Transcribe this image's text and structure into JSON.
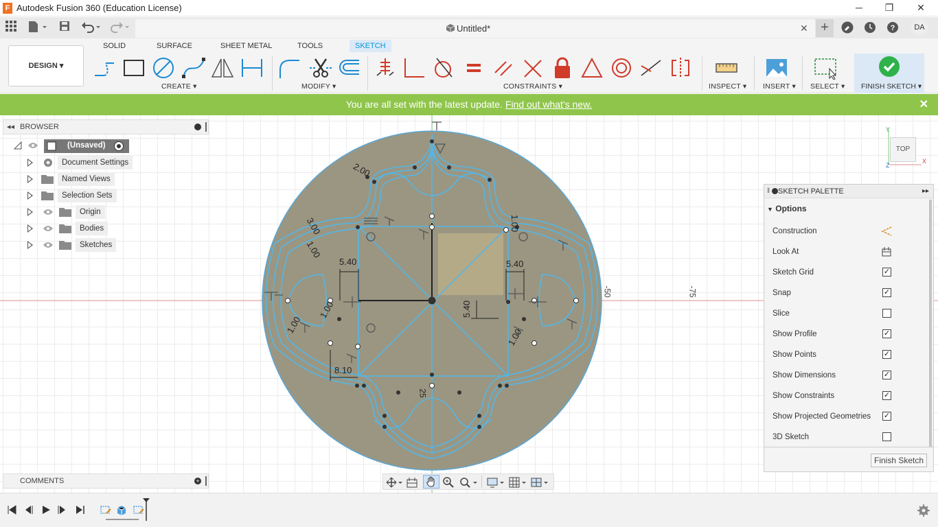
{
  "window": {
    "title": "Autodesk Fusion 360 (Education License)",
    "app_icon_letter": "F",
    "minimize": "─",
    "restore": "❐",
    "close": "✕"
  },
  "tabbar": {
    "document_title": "Untitled*",
    "close": "✕",
    "new_tab": "+",
    "user_initials": "DA"
  },
  "toolbar": {
    "workspace": "DESIGN ▾",
    "tabs": [
      "SOLID",
      "SURFACE",
      "SHEET METAL",
      "TOOLS",
      "SKETCH"
    ],
    "active_tab": "SKETCH",
    "groups": {
      "create": "CREATE ▾",
      "modify": "MODIFY ▾",
      "constraints": "CONSTRAINTS ▾",
      "inspect": "INSPECT ▾",
      "insert": "INSERT ▾",
      "select": "SELECT ▾",
      "finish": "FINISH SKETCH ▾"
    }
  },
  "banner": {
    "message": "You are all set with the latest update. ",
    "link": "Find out what's new.",
    "close": "✕"
  },
  "browser": {
    "title": "BROWSER",
    "root": "(Unsaved)",
    "items": [
      {
        "label": "Document Settings",
        "icon": "gear-icon",
        "eye": false
      },
      {
        "label": "Named Views",
        "icon": "folder-icon",
        "eye": false
      },
      {
        "label": "Selection Sets",
        "icon": "folder-icon",
        "eye": false
      },
      {
        "label": "Origin",
        "icon": "folder-icon",
        "eye": true
      },
      {
        "label": "Bodies",
        "icon": "folder-icon",
        "eye": true
      },
      {
        "label": "Sketches",
        "icon": "folder-icon",
        "eye": true
      }
    ]
  },
  "comments": {
    "title": "COMMENTS"
  },
  "sketch_palette": {
    "title": "SKETCH PALETTE",
    "section": "Options",
    "options": [
      {
        "label": "Construction",
        "type": "icon",
        "icon": "construction-icon"
      },
      {
        "label": "Look At",
        "type": "icon",
        "icon": "look-at-icon"
      },
      {
        "label": "Sketch Grid",
        "type": "checkbox",
        "checked": true
      },
      {
        "label": "Snap",
        "type": "checkbox",
        "checked": true
      },
      {
        "label": "Slice",
        "type": "checkbox",
        "checked": false
      },
      {
        "label": "Show Profile",
        "type": "checkbox",
        "checked": true
      },
      {
        "label": "Show Points",
        "type": "checkbox",
        "checked": true
      },
      {
        "label": "Show Dimensions",
        "type": "checkbox",
        "checked": true
      },
      {
        "label": "Show Constraints",
        "type": "checkbox",
        "checked": true
      },
      {
        "label": "Show Projected Geometries",
        "type": "checkbox",
        "checked": true
      },
      {
        "label": "3D Sketch",
        "type": "checkbox",
        "checked": false
      }
    ],
    "finish_button": "Finish Sketch"
  },
  "viewcube": {
    "face": "TOP",
    "x": "X",
    "y": "Y",
    "z": "Z"
  },
  "canvas": {
    "axis_labels": [
      "-50",
      "-75"
    ],
    "dimensions": [
      "2.00",
      "3.00",
      "1.00",
      "5.40",
      "5.40",
      "5.40",
      "1.00",
      "1.00",
      "1.00",
      "1.00",
      "8.10",
      "25"
    ]
  }
}
